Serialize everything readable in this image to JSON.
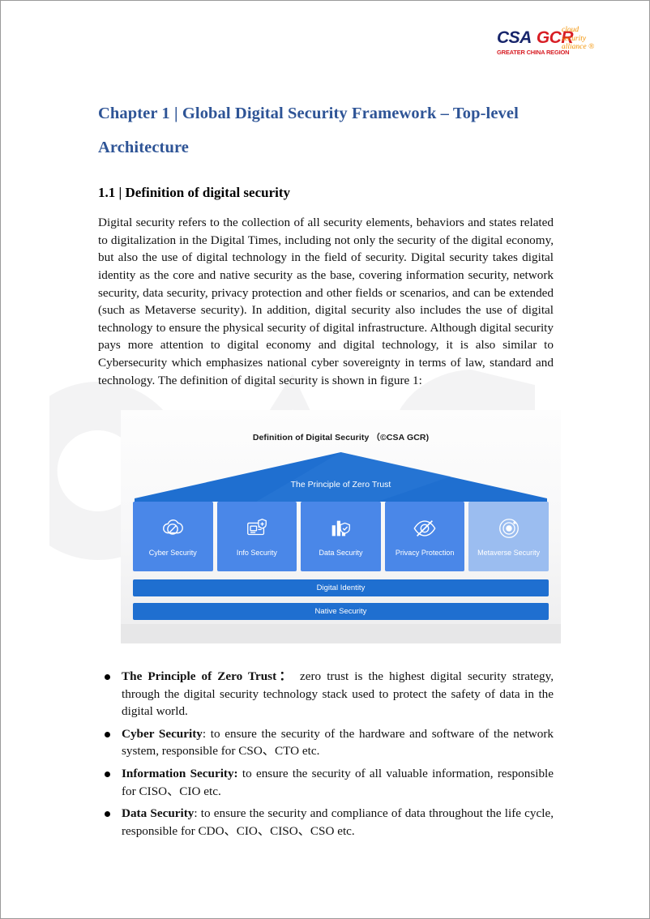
{
  "logo": {
    "csa": "CSA",
    "gcr": "GCR",
    "region": "GREATER CHINA REGION",
    "tagline_line1": "cloud",
    "tagline_line2": "security",
    "tagline_line3": "alliance ®"
  },
  "chapter": {
    "title": "Chapter 1 | Global Digital Security Framework – Top-level Architecture"
  },
  "section": {
    "title": "1.1 | Definition of digital security",
    "paragraph": "Digital security refers to the collection of all security elements, behaviors and states related to digitalization in the Digital Times, including not only the security of the digital economy, but also the use of digital technology in the field of security. Digital security takes digital identity as the core and native security as the base, covering information security, network security, data security, privacy protection and other fields or scenarios, and can be extended (such as Metaverse security). In addition, digital security also includes the use of digital technology to ensure the physical security of digital infrastructure. Although digital security pays more attention to digital economy and digital technology, it is also similar to Cybersecurity which emphasizes national cyber sovereignty in terms of law, standard and technology. The definition of digital security is shown in figure 1:"
  },
  "figure": {
    "title": "Definition of Digital Security （©CSA GCR)",
    "roof_label": "The Principle of Zero Trust",
    "pillars": [
      {
        "label": "Cyber Security",
        "icon": "cloud-shield-icon",
        "color": "#4a87e8"
      },
      {
        "label": "Info Security",
        "icon": "document-shield-icon",
        "color": "#4a87e8"
      },
      {
        "label": "Data Security",
        "icon": "bar-chart-shield-icon",
        "color": "#4a87e8"
      },
      {
        "label": "Privacy Protection",
        "icon": "eye-slash-icon",
        "color": "#4a87e8"
      },
      {
        "label": "Metaverse Security",
        "icon": "atom-orbit-icon",
        "color": "#9bbdf0"
      }
    ],
    "bands": [
      {
        "label": "Digital Identity",
        "color": "#1f6fd0"
      },
      {
        "label": "Native Security",
        "color": "#1f6fd0"
      }
    ],
    "roof_color": "#1f6fd0"
  },
  "bullets": [
    {
      "term": "The Principle of Zero Trust",
      "separator": "：",
      "text": " zero trust is the highest digital security strategy, through the digital security technology stack used to protect the safety of data in the digital world."
    },
    {
      "term": "Cyber Security",
      "separator": ":",
      "text": " to ensure the security of the hardware and software of the network system, responsible for CSO、CTO etc."
    },
    {
      "term": "Information Security:",
      "separator": "",
      "text": " to ensure the security of all valuable information, responsible for CISO、CIO etc."
    },
    {
      "term": "Data Security",
      "separator": ":",
      "text": " to ensure the security and compliance of data throughout the life cycle, responsible for CDO、CIO、CISO、CSO etc."
    }
  ],
  "watermark": {
    "text": "CSA"
  },
  "colors": {
    "heading_blue": "#2e5496",
    "logo_navy": "#17256b",
    "logo_red": "#d81e25",
    "logo_orange": "#f29100",
    "figure_blue": "#1f6fd0",
    "pillar_blue": "#4a87e8",
    "pillar_light_blue": "#9bbdf0"
  }
}
